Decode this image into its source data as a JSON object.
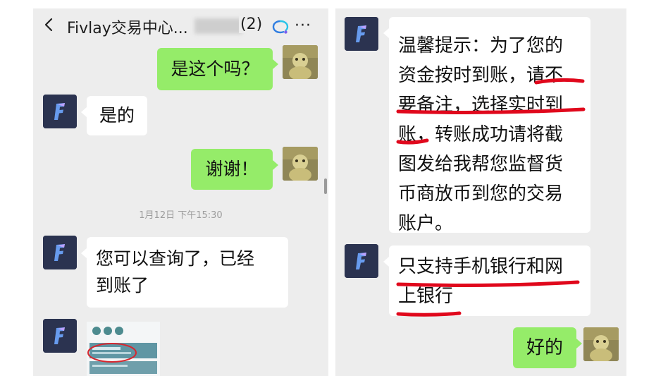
{
  "chat": {
    "title": "Fivlay交易中心...",
    "title_count": "(2)",
    "back_icon": "chevron-left-icon",
    "more_label": "···"
  },
  "left_messages": [
    {
      "side": "right",
      "text": "是这个吗？"
    },
    {
      "side": "left",
      "text": "是的"
    },
    {
      "side": "right",
      "text": "谢谢！"
    },
    {
      "side": "left",
      "text": "您可以查询了，已经到账了"
    }
  ],
  "left_lines": {
    "m4_line1": "您可以查询了，已经",
    "m4_line2": "到账了"
  },
  "timestamp": "1月12日 下午15:30",
  "right_messages": {
    "tip_lines": [
      "温馨提示：为了您的",
      "资金按时到账，请不",
      "要备注，选择实时到",
      "账，转账成功请将截",
      "图发给我帮您监督货",
      "币商放币到您的交易",
      "账户。"
    ],
    "bank_lines": [
      "只支持手机银行和网",
      "上银行"
    ],
    "reply": "好的"
  },
  "colors": {
    "background": "#ededed",
    "bubble_green": "#95ec69",
    "bubble_white": "#ffffff",
    "highlight_red": "#e0081c"
  }
}
